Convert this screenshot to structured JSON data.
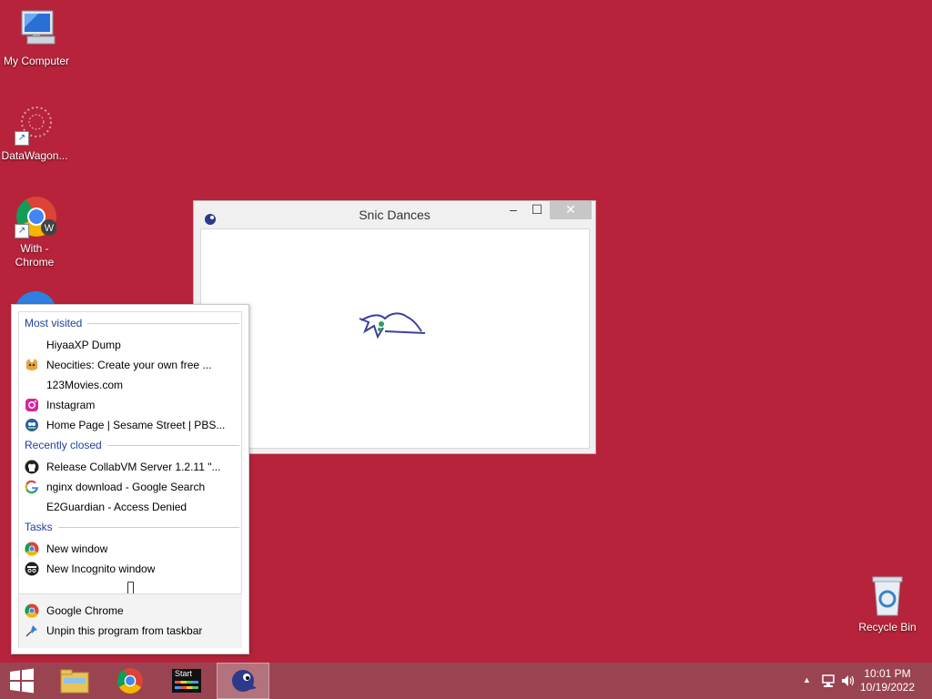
{
  "desktop": {
    "icons": [
      {
        "label": "My Computer"
      },
      {
        "label": "DataWagon..."
      },
      {
        "label": "With -\nChrome"
      },
      {
        "label": "Recycle Bin"
      }
    ],
    "background_color": "#b7233a"
  },
  "window": {
    "title": "Snic Dances",
    "controls": {
      "minimize": "–",
      "maximize": "☐",
      "close": "✕"
    }
  },
  "jumplist": {
    "most_visited_header": "Most visited",
    "most_visited": [
      {
        "label": "HiyaaXP Dump",
        "icon": "none"
      },
      {
        "label": "Neocities: Create your own free ...",
        "icon": "neocities-cat-icon"
      },
      {
        "label": "123Movies.com",
        "icon": "none"
      },
      {
        "label": "Instagram",
        "icon": "instagram-icon"
      },
      {
        "label": "Home Page | Sesame Street | PBS...",
        "icon": "pbs-kids-icon"
      }
    ],
    "recently_closed_header": "Recently closed",
    "recently_closed": [
      {
        "label": "Release CollabVM Server 1.2.11 \"...",
        "icon": "github-icon"
      },
      {
        "label": "nginx download - Google Search",
        "icon": "google-icon"
      },
      {
        "label": "E2Guardian - Access Denied",
        "icon": "none"
      }
    ],
    "tasks_header": "Tasks",
    "tasks": [
      {
        "label": "New window",
        "icon": "chrome-icon"
      },
      {
        "label": "New Incognito window",
        "icon": "incognito-icon"
      }
    ],
    "footer": [
      {
        "label": "Google Chrome",
        "icon": "chrome-icon"
      },
      {
        "label": "Unpin this program from taskbar",
        "icon": "unpin-icon"
      }
    ]
  },
  "taskbar": {
    "start_icon": "windows-logo-icon",
    "pinned": [
      "file-explorer-icon",
      "chrome-icon",
      "start-app-icon",
      "sonic-app-icon"
    ],
    "start_app_label": "Start",
    "tray": {
      "time": "10:01 PM",
      "date": "10/19/2022"
    },
    "color": "#9a4451"
  }
}
